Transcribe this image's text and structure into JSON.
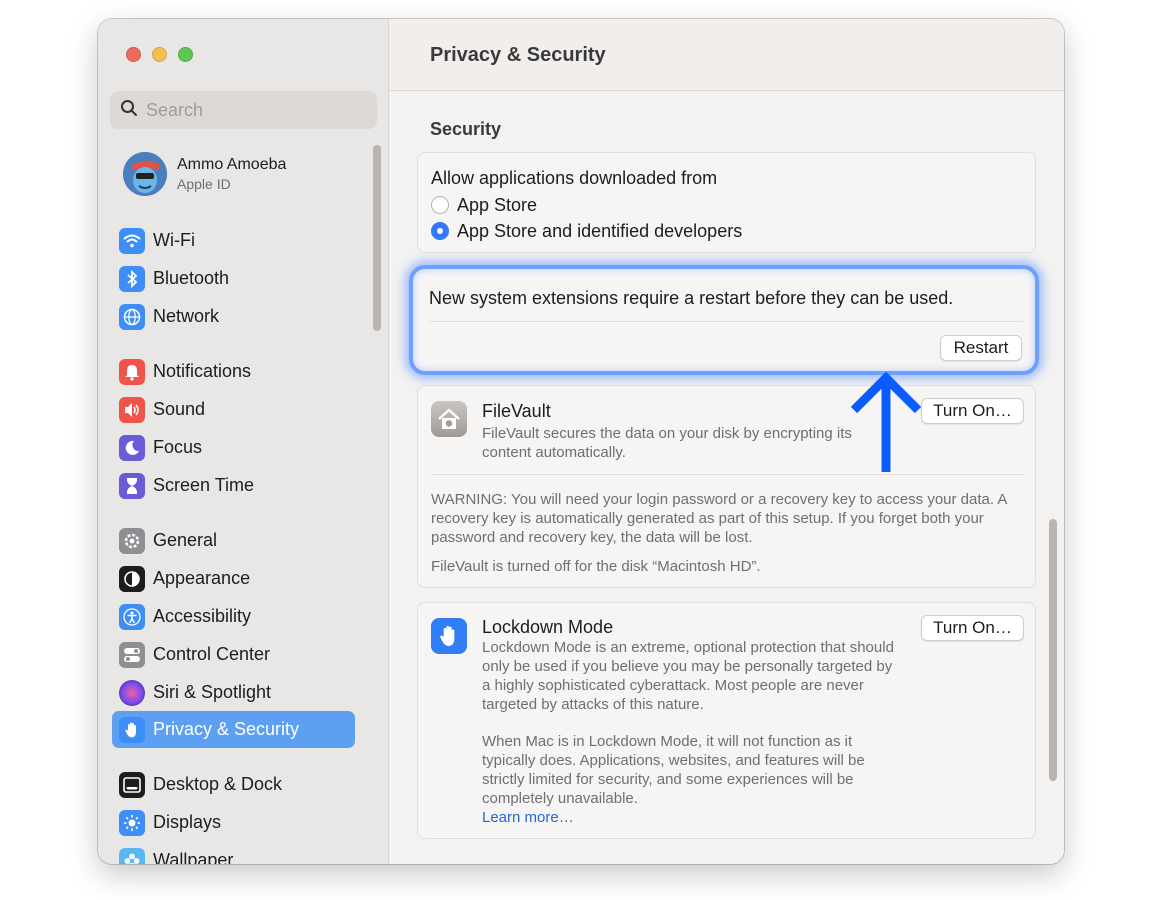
{
  "sidebar": {
    "search_placeholder": "Search",
    "profile": {
      "name": "Ammo Amoeba",
      "subtitle": "Apple ID"
    },
    "items": [
      {
        "label": "Wi-Fi",
        "icon": "wifi-icon",
        "color": "#3e8ef7"
      },
      {
        "label": "Bluetooth",
        "icon": "bluetooth-icon",
        "color": "#3e8ef7"
      },
      {
        "label": "Network",
        "icon": "globe-icon",
        "color": "#3e8ef7"
      },
      {
        "label": "Notifications",
        "icon": "bell-icon",
        "color": "#f0534a"
      },
      {
        "label": "Sound",
        "icon": "speaker-icon",
        "color": "#f0534a"
      },
      {
        "label": "Focus",
        "icon": "moon-icon",
        "color": "#6a5bd8"
      },
      {
        "label": "Screen Time",
        "icon": "hourglass-icon",
        "color": "#6a5bd8"
      },
      {
        "label": "General",
        "icon": "gear-icon",
        "color": "#8e8e93"
      },
      {
        "label": "Appearance",
        "icon": "appearance-icon",
        "color": "#1d1d1f"
      },
      {
        "label": "Accessibility",
        "icon": "accessibility-icon",
        "color": "#3e8ef7"
      },
      {
        "label": "Control Center",
        "icon": "toggles-icon",
        "color": "#8e8e93"
      },
      {
        "label": "Siri & Spotlight",
        "icon": "siri-icon",
        "color": "#5b3fd1"
      },
      {
        "label": "Privacy & Security",
        "icon": "hand-icon",
        "color": "#3e8ef7"
      },
      {
        "label": "Desktop & Dock",
        "icon": "dock-icon",
        "color": "#1d1d1f"
      },
      {
        "label": "Displays",
        "icon": "sun-icon",
        "color": "#3e8ef7"
      },
      {
        "label": "Wallpaper",
        "icon": "flower-icon",
        "color": "#5ab6f0"
      }
    ],
    "selected": "Privacy & Security"
  },
  "header": {
    "title": "Privacy & Security"
  },
  "security": {
    "section_title": "Security",
    "allow_label": "Allow applications downloaded from",
    "options": [
      "App Store",
      "App Store and identified developers"
    ],
    "selected_option": "App Store and identified developers",
    "restart_notice": "New system extensions require a restart before they can be used.",
    "restart_button": "Restart"
  },
  "filevault": {
    "title": "FileVault",
    "description": "FileVault secures the data on your disk by encrypting its content automatically.",
    "button": "Turn On…",
    "warning": "WARNING: You will need your login password or a recovery key to access your data. A recovery key is automatically generated as part of this setup. If you forget both your password and recovery key, the data will be lost.",
    "status": "FileVault is turned off for the disk “Macintosh HD”."
  },
  "lockdown": {
    "title": "Lockdown Mode",
    "description": "Lockdown Mode is an extreme, optional protection that should only be used if you believe you may be personally targeted by a highly sophisticated cyberattack. Most people are never targeted by attacks of this nature.",
    "details": "When Mac is in Lockdown Mode, it will not function as it typically does. Applications, websites, and features will be strictly limited for security, and some experiences will be completely unavailable.",
    "link": "Learn more…",
    "button": "Turn On…"
  },
  "colors": {
    "accent": "#3478f6",
    "highlight": "#6ea0ff",
    "arrow": "#0a5cff"
  }
}
